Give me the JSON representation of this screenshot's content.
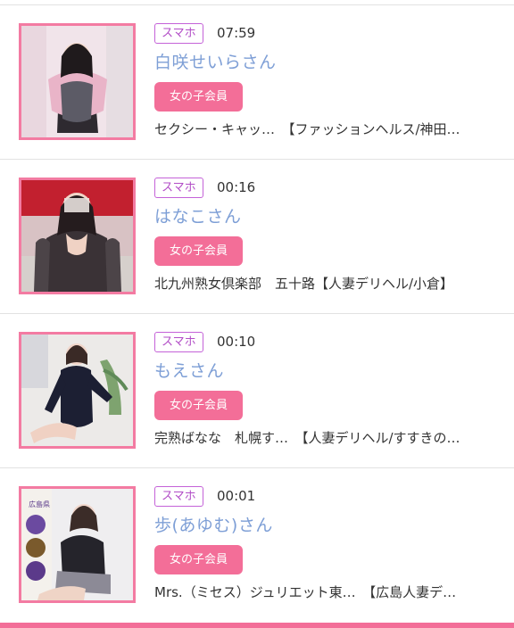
{
  "colors": {
    "accent_pink": "#f36e98",
    "name_blue": "#7e9fd6",
    "device_badge_purple": "#b24dc7"
  },
  "items": [
    {
      "device": "スマホ",
      "time": "07:59",
      "name": "白咲せいらさん",
      "member_badge": "女の子会員",
      "shop": "セクシー・キャッ…　【ファッションヘルス/神田…"
    },
    {
      "device": "スマホ",
      "time": "00:16",
      "name": "はなこさん",
      "member_badge": "女の子会員",
      "shop": "北九州熟女倶楽部　五十路【人妻デリヘル/小倉】"
    },
    {
      "device": "スマホ",
      "time": "00:10",
      "name": "もえさん",
      "member_badge": "女の子会員",
      "shop": "完熟ばなな　札幌す…　【人妻デリヘル/すすきの…"
    },
    {
      "device": "スマホ",
      "time": "00:01",
      "name": "歩(あゆむ)さん",
      "member_badge": "女の子会員",
      "shop": "Mrs.（ミセス）ジュリエット東…　【広島人妻デ…",
      "thumb_overlay_text": "広島県"
    }
  ]
}
